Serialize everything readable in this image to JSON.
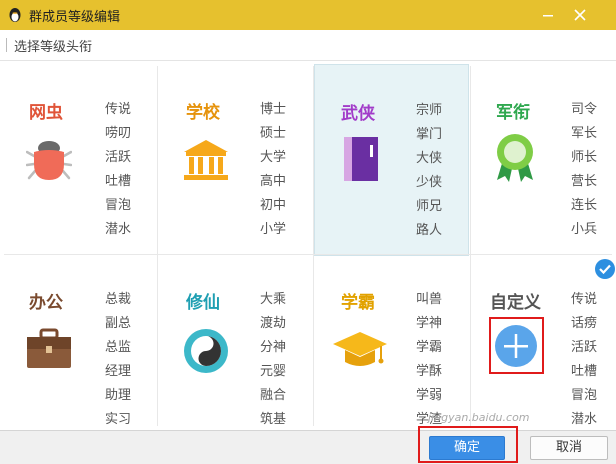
{
  "window": {
    "title": "群成员等级编辑"
  },
  "subheader": {
    "label": "选择等级头衔"
  },
  "categories": [
    {
      "name": "网虫",
      "color": "#e05438",
      "icon": "bug-icon",
      "items": [
        "传说",
        "唠叨",
        "活跃",
        "吐槽",
        "冒泡",
        "潜水"
      ]
    },
    {
      "name": "学校",
      "color": "#e6930c",
      "icon": "school-building-icon",
      "items": [
        "博士",
        "硕士",
        "大学",
        "高中",
        "初中",
        "小学"
      ]
    },
    {
      "name": "武侠",
      "color": "#a23cc9",
      "icon": "book-icon",
      "items": [
        "宗师",
        "掌门",
        "大侠",
        "少侠",
        "师兄",
        "路人"
      ],
      "selected_bg": "#e7f3f6"
    },
    {
      "name": "军衔",
      "color": "#2fa84f",
      "icon": "medal-icon",
      "items": [
        "司令",
        "军长",
        "师长",
        "营长",
        "连长",
        "小兵"
      ]
    },
    {
      "name": "办公",
      "color": "#7a4a2e",
      "icon": "briefcase-icon",
      "items": [
        "总裁",
        "副总",
        "总监",
        "经理",
        "助理",
        "实习"
      ]
    },
    {
      "name": "修仙",
      "color": "#1f9fb2",
      "icon": "yin-yang-icon",
      "items": [
        "大乘",
        "渡劫",
        "分神",
        "元婴",
        "融合",
        "筑基"
      ]
    },
    {
      "name": "学霸",
      "color": "#e2a200",
      "icon": "graduation-cap-icon",
      "items": [
        "叫兽",
        "学神",
        "学霸",
        "学酥",
        "学弱",
        "学渣"
      ]
    },
    {
      "name": "自定义",
      "color": "#555555",
      "icon": "plus-circle-icon",
      "items": [
        "传说",
        "话痨",
        "活跃",
        "吐槽",
        "冒泡",
        "潜水"
      ]
    }
  ],
  "footer": {
    "ok_label": "确定",
    "cancel_label": "取消"
  },
  "watermark": "jingyan.baidu.com"
}
